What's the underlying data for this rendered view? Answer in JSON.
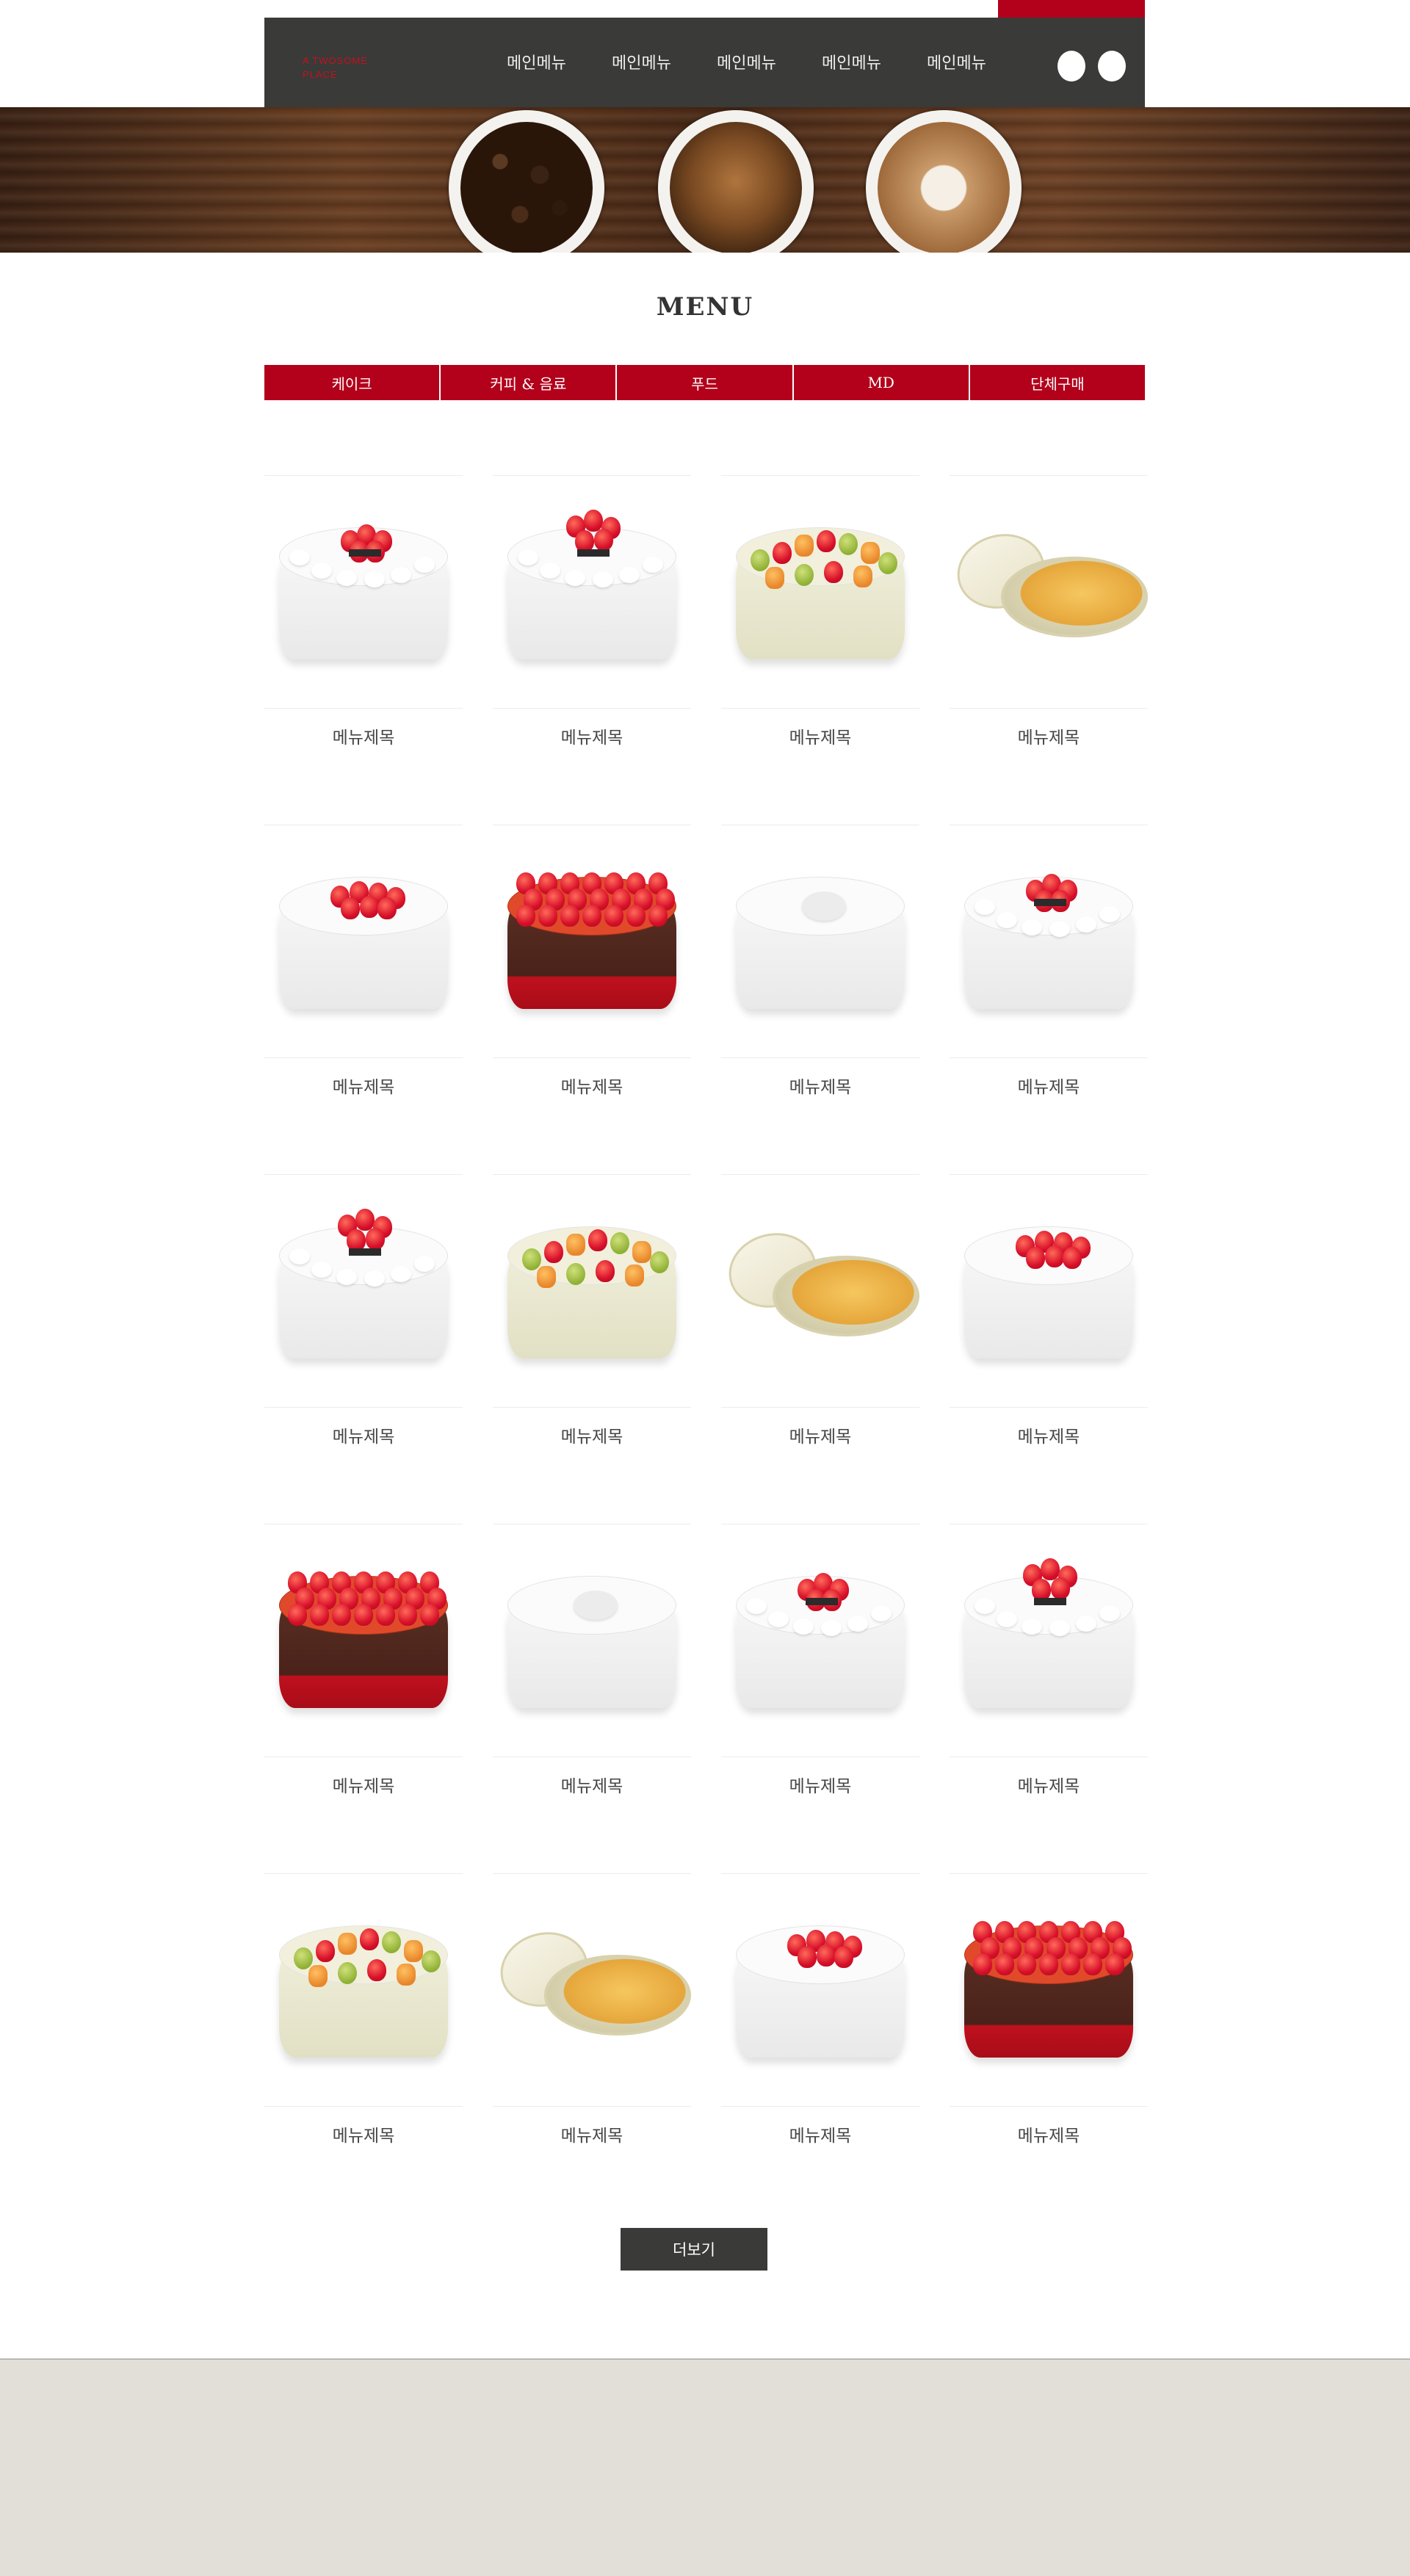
{
  "header": {
    "logo_text": "A TWOSOME PLACE",
    "nav": [
      "메인메뉴",
      "메인메뉴",
      "메인메뉴",
      "메인메뉴",
      "메인메뉴"
    ]
  },
  "page_title": "MENU",
  "tabs": [
    "케이크",
    "커피 & 음료",
    "푸드",
    "MD",
    "단체구매"
  ],
  "products": [
    {
      "label": "메뉴제목",
      "kind": "strawberry-puff"
    },
    {
      "label": "메뉴제목",
      "kind": "strawberry-tall"
    },
    {
      "label": "메뉴제목",
      "kind": "fruit-cream"
    },
    {
      "label": "메뉴제목",
      "kind": "cheesecake"
    },
    {
      "label": "메뉴제목",
      "kind": "strawberry-white"
    },
    {
      "label": "메뉴제목",
      "kind": "strawberry-choco"
    },
    {
      "label": "메뉴제목",
      "kind": "cafe-latte"
    },
    {
      "label": "메뉴제목",
      "kind": "strawberry-puff"
    },
    {
      "label": "메뉴제목",
      "kind": "strawberry-tall"
    },
    {
      "label": "메뉴제목",
      "kind": "fruit-cream"
    },
    {
      "label": "메뉴제목",
      "kind": "cheesecake"
    },
    {
      "label": "메뉴제목",
      "kind": "strawberry-white"
    },
    {
      "label": "메뉴제목",
      "kind": "strawberry-choco"
    },
    {
      "label": "메뉴제목",
      "kind": "cafe-latte"
    },
    {
      "label": "메뉴제목",
      "kind": "strawberry-puff"
    },
    {
      "label": "메뉴제목",
      "kind": "strawberry-tall"
    },
    {
      "label": "메뉴제목",
      "kind": "fruit-cream"
    },
    {
      "label": "메뉴제목",
      "kind": "cheesecake"
    },
    {
      "label": "메뉴제목",
      "kind": "strawberry-white"
    },
    {
      "label": "메뉴제목",
      "kind": "strawberry-choco"
    }
  ],
  "more_button": "더보기",
  "colors": {
    "accent": "#b3001b",
    "dark": "#3a3a38",
    "footer": "#e2dfd8"
  }
}
